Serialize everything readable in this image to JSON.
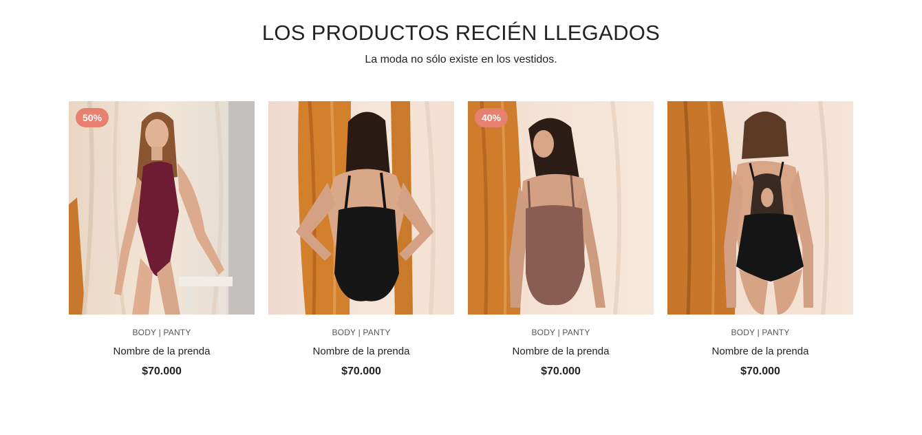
{
  "section": {
    "title": "LOS PRODUCTOS RECIÉN LLEGADOS",
    "subtitle": "La moda no sólo existe en los vestidos."
  },
  "colors": {
    "badge": "#e8806f",
    "text": "#222222",
    "category_text": "#555555"
  },
  "products": [
    {
      "badge": "50%",
      "category": "BODY | PANTY",
      "name": "Nombre de la prenda",
      "price": "$70.000",
      "garment_color": "#6e1b34",
      "view": "front"
    },
    {
      "badge": "",
      "category": "BODY | PANTY",
      "name": "Nombre de la prenda",
      "price": "$70.000",
      "garment_color": "#161616",
      "view": "back"
    },
    {
      "badge": "40%",
      "category": "BODY | PANTY",
      "name": "Nombre de la prenda",
      "price": "$70.000",
      "garment_color": "#8a5d52",
      "view": "back"
    },
    {
      "badge": "",
      "category": "BODY | PANTY",
      "name": "Nombre de la prenda",
      "price": "$70.000",
      "garment_color": "#151515",
      "view": "back"
    }
  ]
}
